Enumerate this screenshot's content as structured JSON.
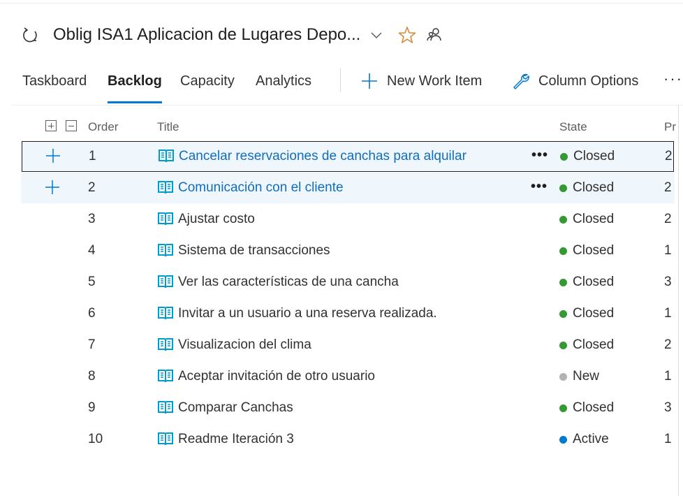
{
  "header": {
    "title": "Oblig ISA1 Aplicacion de Lugares Depo...",
    "icons": {
      "sprint": "sprint-cycle-icon",
      "chevron": "chevron-down-icon",
      "favorite": "star-icon",
      "team": "team-people-icon"
    },
    "star_color": "#d68a3a"
  },
  "tabs": [
    {
      "label": "Taskboard",
      "selected": false
    },
    {
      "label": "Backlog",
      "selected": true
    },
    {
      "label": "Capacity",
      "selected": false
    },
    {
      "label": "Analytics",
      "selected": false
    }
  ],
  "commands": {
    "new_work_item": "New Work Item",
    "column_options": "Column Options",
    "more": "···"
  },
  "columns": {
    "order": "Order",
    "title": "Title",
    "state": "State",
    "priority": "Pr"
  },
  "colors": {
    "accent": "#0078d4",
    "closed": "#339933",
    "new": "#b2b2b2",
    "active": "#007acc",
    "selected_row": "#eff6fc",
    "link": "#106ebe"
  },
  "rows": [
    {
      "order": "1",
      "title": "Cancelar reservaciones de canchas para alquilar",
      "state": "Closed",
      "priority": "2",
      "selected": true,
      "focused": true
    },
    {
      "order": "2",
      "title": "Comunicación con el cliente",
      "state": "Closed",
      "priority": "2",
      "selected": true,
      "focused": false
    },
    {
      "order": "3",
      "title": "Ajustar costo",
      "state": "Closed",
      "priority": "2",
      "selected": false,
      "focused": false
    },
    {
      "order": "4",
      "title": "Sistema de transacciones",
      "state": "Closed",
      "priority": "1",
      "selected": false,
      "focused": false
    },
    {
      "order": "5",
      "title": "Ver las características de una cancha",
      "state": "Closed",
      "priority": "3",
      "selected": false,
      "focused": false
    },
    {
      "order": "6",
      "title": "Invitar a un usuario a una reserva realizada.",
      "state": "Closed",
      "priority": "1",
      "selected": false,
      "focused": false
    },
    {
      "order": "7",
      "title": "Visualizacion del clima",
      "state": "Closed",
      "priority": "2",
      "selected": false,
      "focused": false
    },
    {
      "order": "8",
      "title": "Aceptar invitación de otro usuario",
      "state": "New",
      "priority": "1",
      "selected": false,
      "focused": false
    },
    {
      "order": "9",
      "title": "Comparar Canchas",
      "state": "Closed",
      "priority": "3",
      "selected": false,
      "focused": false
    },
    {
      "order": "10",
      "title": "Readme Iteración 3",
      "state": "Active",
      "priority": "1",
      "selected": false,
      "focused": false
    }
  ]
}
